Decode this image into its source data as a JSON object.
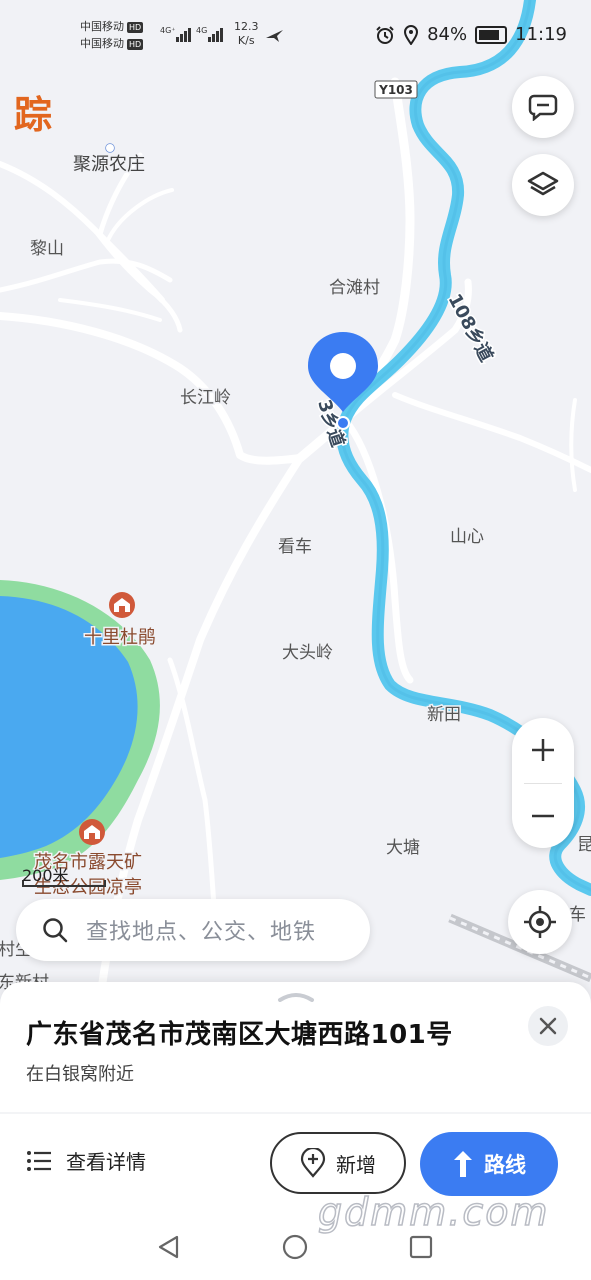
{
  "status_bar": {
    "carrier1": "中国移动",
    "carrier2": "中国移动",
    "hd": "HD",
    "net1": "4G⁺",
    "net2": "4G",
    "speed_value": "12.3",
    "speed_unit": "K/s",
    "battery": "84%",
    "time": "11:19"
  },
  "logo_fragment": "踪",
  "map": {
    "road_label_y103": "Y103",
    "labels": {
      "juyuan": "聚源农庄",
      "lishan": "黎山",
      "hetan": "合滩村",
      "changjiang": "长江岭",
      "kanche": "看车",
      "shanxin": "山心",
      "shili": "十里杜鹃",
      "datouling": "大头岭",
      "xintian": "新田",
      "maoming_park_1": "茂名市露天矿",
      "maoming_park_2": "生态公园凉亭",
      "datang": "大塘",
      "edge_kun": "昆",
      "edge_che": "车",
      "edge_cun": "村生",
      "edge_dong": "东新村",
      "road_108": "108乡道",
      "road_3": "3乡道"
    },
    "scale": "200米"
  },
  "search": {
    "placeholder": "查找地点、公交、地铁"
  },
  "sheet": {
    "address": "广东省茂名市茂南区大塘西路101号",
    "nearby": "在白银窝附近",
    "details_label": "查看详情",
    "add_label": "新增",
    "route_label": "路线"
  },
  "watermark": "gdmm.com",
  "colors": {
    "river": "#5bc8ee",
    "lake": "#4aa9f0",
    "park": "#8fdca0",
    "pin": "#3b7cf2",
    "accent": "#3b7cf2",
    "poi": "#d0593a"
  }
}
